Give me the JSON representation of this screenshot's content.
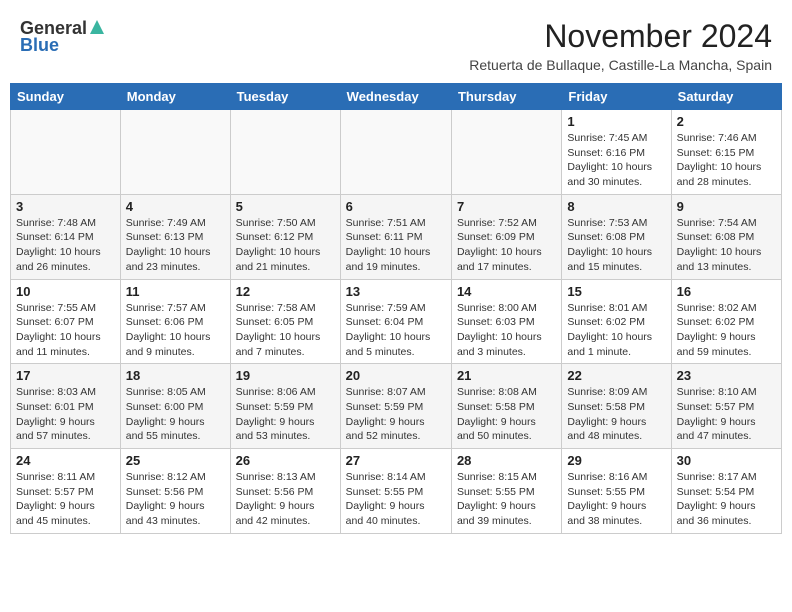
{
  "header": {
    "logo_general": "General",
    "logo_blue": "Blue",
    "month": "November 2024",
    "location": "Retuerta de Bullaque, Castille-La Mancha, Spain"
  },
  "weekdays": [
    "Sunday",
    "Monday",
    "Tuesday",
    "Wednesday",
    "Thursday",
    "Friday",
    "Saturday"
  ],
  "weeks": [
    [
      {
        "day": "",
        "info": ""
      },
      {
        "day": "",
        "info": ""
      },
      {
        "day": "",
        "info": ""
      },
      {
        "day": "",
        "info": ""
      },
      {
        "day": "",
        "info": ""
      },
      {
        "day": "1",
        "info": "Sunrise: 7:45 AM\nSunset: 6:16 PM\nDaylight: 10 hours\nand 30 minutes."
      },
      {
        "day": "2",
        "info": "Sunrise: 7:46 AM\nSunset: 6:15 PM\nDaylight: 10 hours\nand 28 minutes."
      }
    ],
    [
      {
        "day": "3",
        "info": "Sunrise: 7:48 AM\nSunset: 6:14 PM\nDaylight: 10 hours\nand 26 minutes."
      },
      {
        "day": "4",
        "info": "Sunrise: 7:49 AM\nSunset: 6:13 PM\nDaylight: 10 hours\nand 23 minutes."
      },
      {
        "day": "5",
        "info": "Sunrise: 7:50 AM\nSunset: 6:12 PM\nDaylight: 10 hours\nand 21 minutes."
      },
      {
        "day": "6",
        "info": "Sunrise: 7:51 AM\nSunset: 6:11 PM\nDaylight: 10 hours\nand 19 minutes."
      },
      {
        "day": "7",
        "info": "Sunrise: 7:52 AM\nSunset: 6:09 PM\nDaylight: 10 hours\nand 17 minutes."
      },
      {
        "day": "8",
        "info": "Sunrise: 7:53 AM\nSunset: 6:08 PM\nDaylight: 10 hours\nand 15 minutes."
      },
      {
        "day": "9",
        "info": "Sunrise: 7:54 AM\nSunset: 6:08 PM\nDaylight: 10 hours\nand 13 minutes."
      }
    ],
    [
      {
        "day": "10",
        "info": "Sunrise: 7:55 AM\nSunset: 6:07 PM\nDaylight: 10 hours\nand 11 minutes."
      },
      {
        "day": "11",
        "info": "Sunrise: 7:57 AM\nSunset: 6:06 PM\nDaylight: 10 hours\nand 9 minutes."
      },
      {
        "day": "12",
        "info": "Sunrise: 7:58 AM\nSunset: 6:05 PM\nDaylight: 10 hours\nand 7 minutes."
      },
      {
        "day": "13",
        "info": "Sunrise: 7:59 AM\nSunset: 6:04 PM\nDaylight: 10 hours\nand 5 minutes."
      },
      {
        "day": "14",
        "info": "Sunrise: 8:00 AM\nSunset: 6:03 PM\nDaylight: 10 hours\nand 3 minutes."
      },
      {
        "day": "15",
        "info": "Sunrise: 8:01 AM\nSunset: 6:02 PM\nDaylight: 10 hours\nand 1 minute."
      },
      {
        "day": "16",
        "info": "Sunrise: 8:02 AM\nSunset: 6:02 PM\nDaylight: 9 hours\nand 59 minutes."
      }
    ],
    [
      {
        "day": "17",
        "info": "Sunrise: 8:03 AM\nSunset: 6:01 PM\nDaylight: 9 hours\nand 57 minutes."
      },
      {
        "day": "18",
        "info": "Sunrise: 8:05 AM\nSunset: 6:00 PM\nDaylight: 9 hours\nand 55 minutes."
      },
      {
        "day": "19",
        "info": "Sunrise: 8:06 AM\nSunset: 5:59 PM\nDaylight: 9 hours\nand 53 minutes."
      },
      {
        "day": "20",
        "info": "Sunrise: 8:07 AM\nSunset: 5:59 PM\nDaylight: 9 hours\nand 52 minutes."
      },
      {
        "day": "21",
        "info": "Sunrise: 8:08 AM\nSunset: 5:58 PM\nDaylight: 9 hours\nand 50 minutes."
      },
      {
        "day": "22",
        "info": "Sunrise: 8:09 AM\nSunset: 5:58 PM\nDaylight: 9 hours\nand 48 minutes."
      },
      {
        "day": "23",
        "info": "Sunrise: 8:10 AM\nSunset: 5:57 PM\nDaylight: 9 hours\nand 47 minutes."
      }
    ],
    [
      {
        "day": "24",
        "info": "Sunrise: 8:11 AM\nSunset: 5:57 PM\nDaylight: 9 hours\nand 45 minutes."
      },
      {
        "day": "25",
        "info": "Sunrise: 8:12 AM\nSunset: 5:56 PM\nDaylight: 9 hours\nand 43 minutes."
      },
      {
        "day": "26",
        "info": "Sunrise: 8:13 AM\nSunset: 5:56 PM\nDaylight: 9 hours\nand 42 minutes."
      },
      {
        "day": "27",
        "info": "Sunrise: 8:14 AM\nSunset: 5:55 PM\nDaylight: 9 hours\nand 40 minutes."
      },
      {
        "day": "28",
        "info": "Sunrise: 8:15 AM\nSunset: 5:55 PM\nDaylight: 9 hours\nand 39 minutes."
      },
      {
        "day": "29",
        "info": "Sunrise: 8:16 AM\nSunset: 5:55 PM\nDaylight: 9 hours\nand 38 minutes."
      },
      {
        "day": "30",
        "info": "Sunrise: 8:17 AM\nSunset: 5:54 PM\nDaylight: 9 hours\nand 36 minutes."
      }
    ]
  ]
}
